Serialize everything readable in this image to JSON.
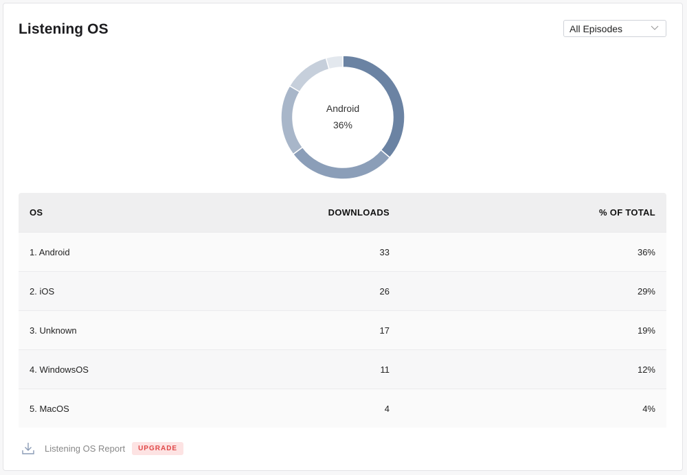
{
  "title": "Listening OS",
  "filter": {
    "selected": "All Episodes",
    "icon": "chevron-down-icon"
  },
  "donut": {
    "label": "Android",
    "value": "36%"
  },
  "table": {
    "headers": {
      "os": "OS",
      "downloads": "DOWNLOADS",
      "percent": "% OF TOTAL"
    },
    "rows": [
      {
        "os": "1. Android",
        "downloads": "33",
        "percent": "36%"
      },
      {
        "os": "2. iOS",
        "downloads": "26",
        "percent": "29%"
      },
      {
        "os": "3. Unknown",
        "downloads": "17",
        "percent": "19%"
      },
      {
        "os": "4. WindowsOS",
        "downloads": "11",
        "percent": "12%"
      },
      {
        "os": "5. MacOS",
        "downloads": "4",
        "percent": "4%"
      }
    ]
  },
  "footer": {
    "report_label": "Listening OS Report",
    "badge": "UPGRADE",
    "icon": "download-icon"
  },
  "chart_data": {
    "type": "pie",
    "categories": [
      "Android",
      "iOS",
      "Unknown",
      "WindowsOS",
      "MacOS"
    ],
    "values": [
      33,
      26,
      17,
      11,
      4
    ],
    "colors": [
      "#6b83a3",
      "#8b9eb8",
      "#a8b6c9",
      "#c6cfdb",
      "#e3e8ee"
    ]
  }
}
